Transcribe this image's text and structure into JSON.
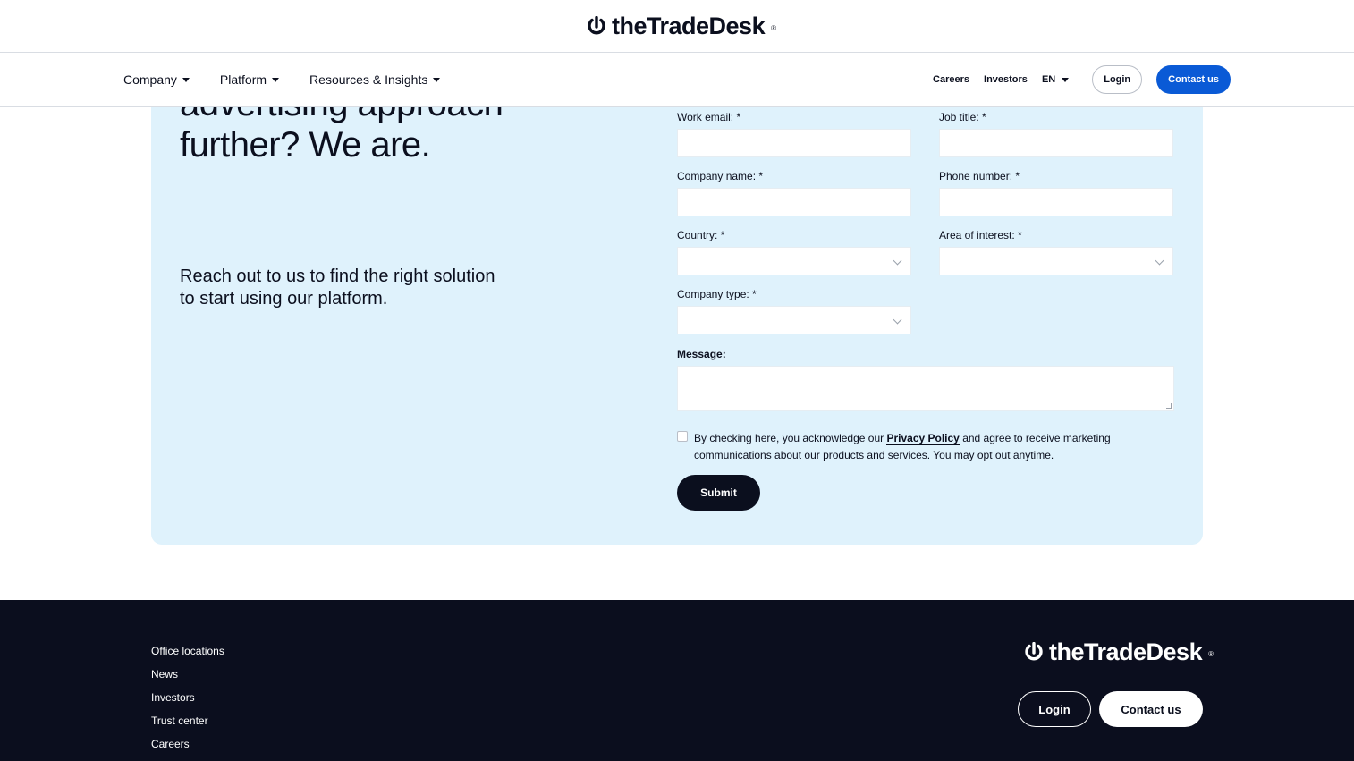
{
  "brand": {
    "name": "theTradeDesk",
    "trademark": "®"
  },
  "nav": {
    "left_items": [
      {
        "label": "Company"
      },
      {
        "label": "Platform"
      },
      {
        "label": "Resources & Insights"
      }
    ],
    "careers": "Careers",
    "investors": "Investors",
    "language": "EN",
    "login": "Login",
    "contact": "Contact us"
  },
  "hero": {
    "headline": "advertising approach further? We are.",
    "sub_text": "Reach out to us to find the right solution to start using ",
    "sub_link": "our platform",
    "sub_end": "."
  },
  "form": {
    "work_email_label": "Work email: *",
    "job_title_label": "Job title: *",
    "company_name_label": "Company name: *",
    "phone_label": "Phone number: *",
    "country_label": "Country: *",
    "area_label": "Area of interest: *",
    "company_type_label": "Company type: *",
    "message_label": "Message:",
    "consent_pre": "By checking here, you acknowledge our ",
    "consent_link": "Privacy Policy",
    "consent_post": " and agree to receive marketing communications about our products and services. You may opt out anytime.",
    "submit": "Submit"
  },
  "footer": {
    "links": [
      {
        "label": "Office locations"
      },
      {
        "label": "News"
      },
      {
        "label": "Investors"
      },
      {
        "label": "Trust center"
      },
      {
        "label": "Careers"
      }
    ],
    "login": "Login",
    "contact": "Contact us"
  },
  "colors": {
    "accent_blue": "#0a5ad6",
    "card_bg": "#dff2fc",
    "footer_bg": "#0b0e1e"
  }
}
